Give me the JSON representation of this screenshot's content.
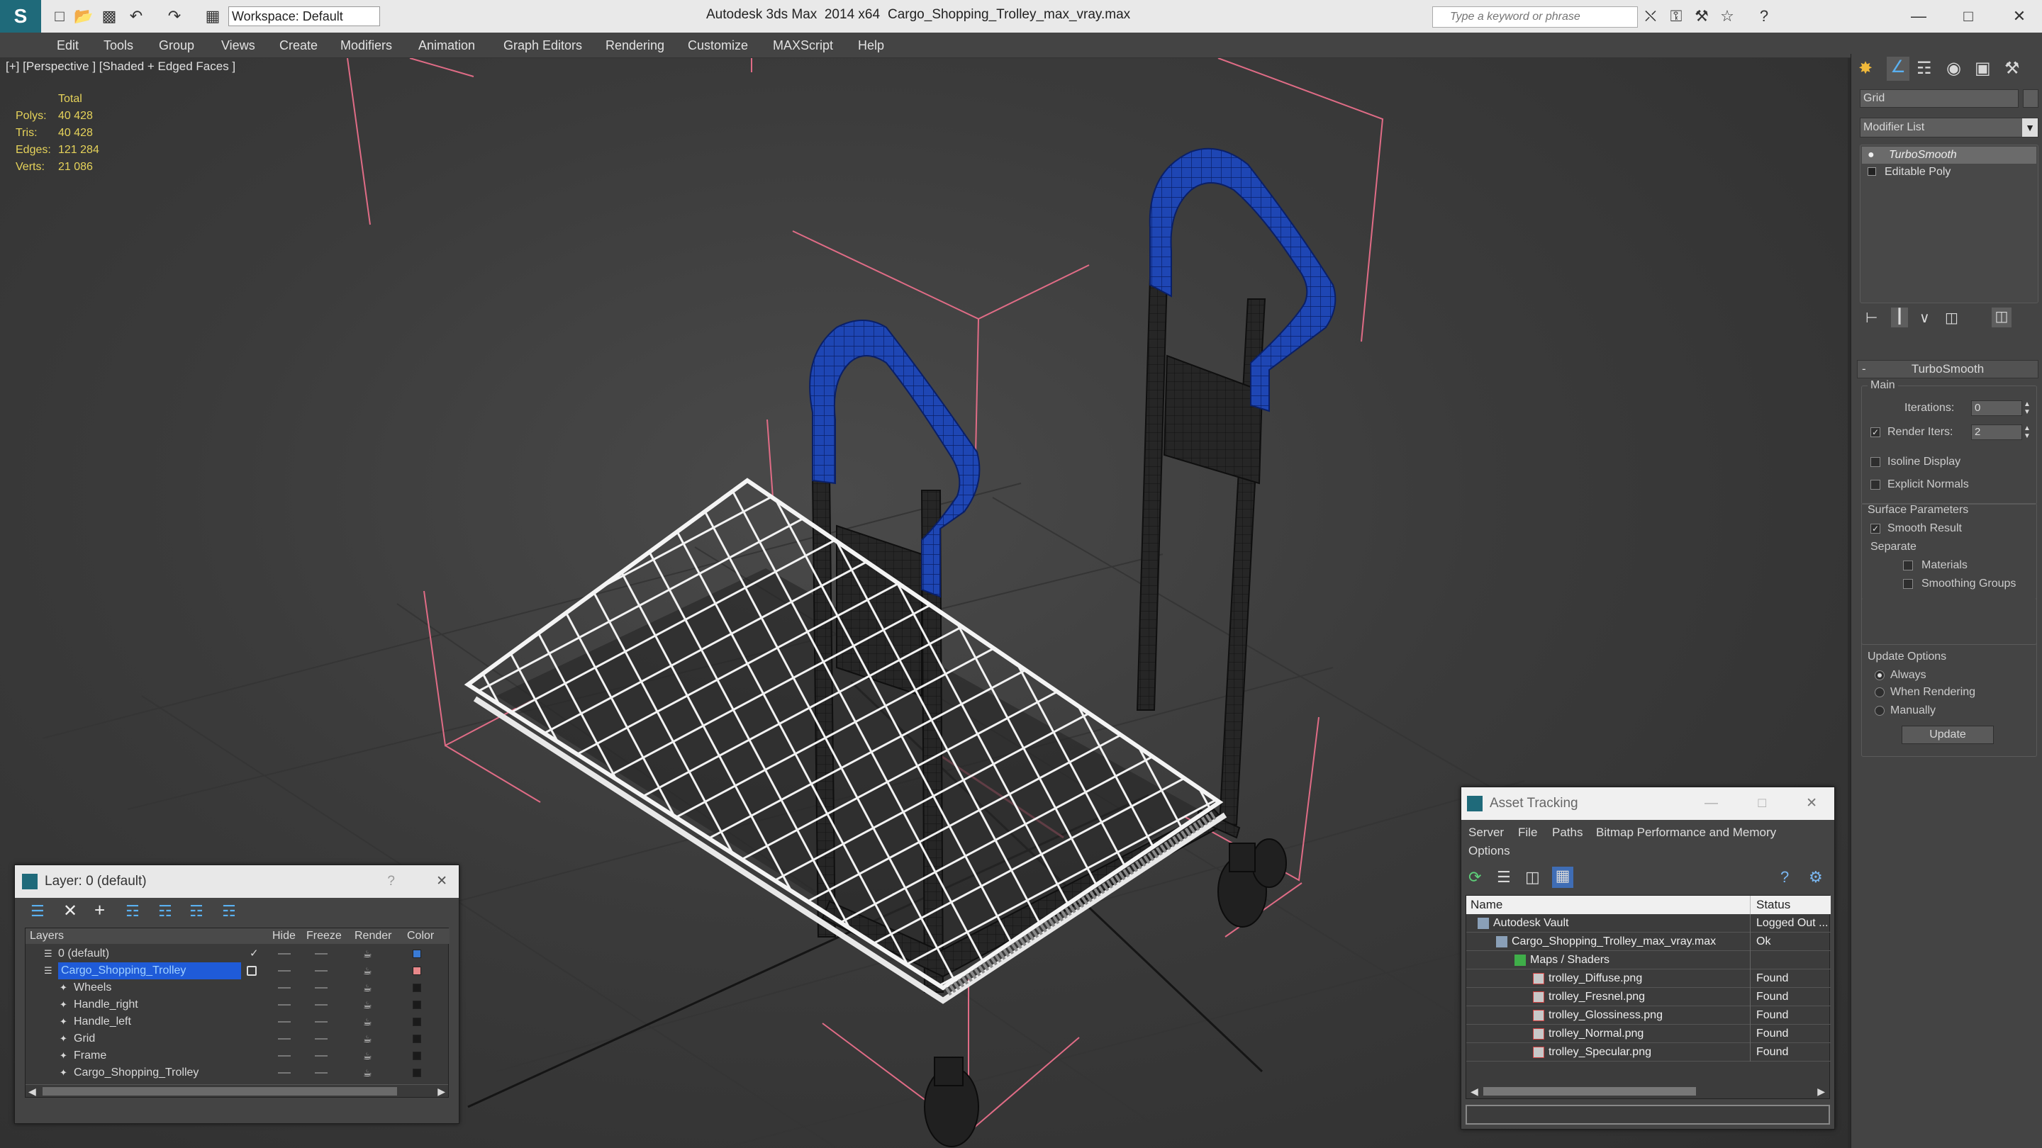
{
  "titlebar": {
    "workspace": "Workspace: Default",
    "app_title": "Autodesk 3ds Max  2014 x64",
    "file_title": "Cargo_Shopping_Trolley_max_vray.max",
    "search_placeholder": "Type a keyword or phrase"
  },
  "menu": [
    "Edit",
    "Tools",
    "Group",
    "Views",
    "Create",
    "Modifiers",
    "Animation",
    "Graph Editors",
    "Rendering",
    "Customize",
    "MAXScript",
    "Help"
  ],
  "viewport": {
    "label": "[+] [Perspective ] [Shaded + Edged Faces ]",
    "stats": {
      "header": "Total",
      "rows": [
        {
          "label": "Polys:",
          "value": "40 428"
        },
        {
          "label": "Tris:",
          "value": "40 428"
        },
        {
          "label": "Edges:",
          "value": "121 284"
        },
        {
          "label": "Verts:",
          "value": "21 086"
        }
      ]
    }
  },
  "command_panel": {
    "object_name": "Grid",
    "modifier_list": "Modifier List",
    "stack": [
      "TurboSmooth",
      "Editable Poly"
    ],
    "rollout_title": "TurboSmooth",
    "main_label": "Main",
    "iterations_label": "Iterations:",
    "iterations_value": "0",
    "render_iters_label": "Render Iters:",
    "render_iters_value": "2",
    "isoline": "Isoline Display",
    "explicit_normals": "Explicit Normals",
    "surface_params": "Surface Parameters",
    "smooth_result": "Smooth Result",
    "separate": "Separate",
    "materials": "Materials",
    "smoothing_groups": "Smoothing Groups",
    "update_options": "Update Options",
    "always": "Always",
    "when_rendering": "When Rendering",
    "manually": "Manually",
    "update_button": "Update"
  },
  "layer_window": {
    "title": "Layer: 0 (default)",
    "help": "?",
    "columns": [
      "Layers",
      "Hide",
      "Freeze",
      "Render",
      "Color"
    ],
    "rows": [
      {
        "name": "0 (default)",
        "indent": 0,
        "color": "#3a7bd5"
      },
      {
        "name": "Cargo_Shopping_Trolley",
        "indent": 0,
        "color": "#e8888a",
        "selected": true
      },
      {
        "name": "Wheels",
        "indent": 1,
        "color": "#1a1a1a"
      },
      {
        "name": "Handle_right",
        "indent": 1,
        "color": "#1a1a1a"
      },
      {
        "name": "Handle_left",
        "indent": 1,
        "color": "#1a1a1a"
      },
      {
        "name": "Grid",
        "indent": 1,
        "color": "#1a1a1a"
      },
      {
        "name": "Frame",
        "indent": 1,
        "color": "#1a1a1a"
      },
      {
        "name": "Cargo_Shopping_Trolley",
        "indent": 1,
        "color": "#1a1a1a"
      }
    ]
  },
  "asset_window": {
    "title": "Asset Tracking",
    "menu": [
      "Server",
      "File",
      "Paths",
      "Bitmap Performance and Memory",
      "Options"
    ],
    "columns": [
      "Name",
      "Status"
    ],
    "rows": [
      {
        "name": "Autodesk Vault",
        "status": "Logged Out ...",
        "indent": 0
      },
      {
        "name": "Cargo_Shopping_Trolley_max_vray.max",
        "status": "Ok",
        "indent": 1
      },
      {
        "name": "Maps / Shaders",
        "status": "",
        "indent": 2
      },
      {
        "name": "trolley_Diffuse.png",
        "status": "Found",
        "indent": 3
      },
      {
        "name": "trolley_Fresnel.png",
        "status": "Found",
        "indent": 3
      },
      {
        "name": "trolley_Glossiness.png",
        "status": "Found",
        "indent": 3
      },
      {
        "name": "trolley_Normal.png",
        "status": "Found",
        "indent": 3
      },
      {
        "name": "trolley_Specular.png",
        "status": "Found",
        "indent": 3
      }
    ]
  },
  "colors": {
    "accent": "#1f5bd8",
    "handle_blue": "#1e46b4",
    "selection_box": "#e06c86"
  }
}
